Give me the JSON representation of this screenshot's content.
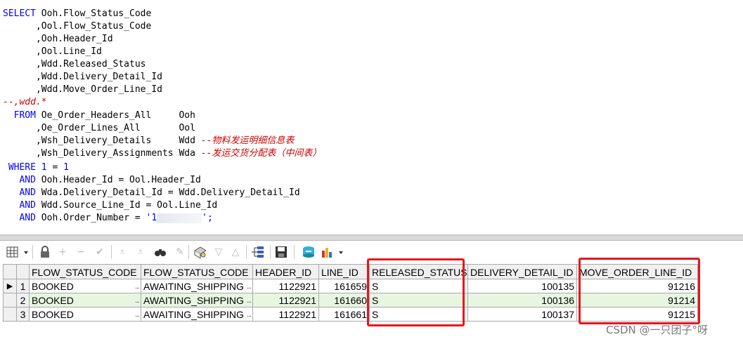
{
  "sql": {
    "line1": "Ooh.Flow_Status_Code",
    "line2": "      ,Ool.Flow_Status_Code",
    "line3": "      ,Ooh.Header_Id",
    "line4": "      ,Ool.Line_Id",
    "line5": "      ,Wdd.Released_Status",
    "line6": "      ,Wdd.Delivery_Detail_Id",
    "line7": "      ,Wdd.Move_Order_Line_Id",
    "line8": "--,wdd.*",
    "kw_select": "SELECT",
    "kw_from": "FROM",
    "kw_where": "WHERE",
    "kw_and": "AND",
    "from1": "Oe_Order_Headers_All     Ooh",
    "from2": "      ,Oe_Order_Lines_All       Ool",
    "from3": "      ,Wsh_Delivery_Details     Wdd ",
    "from3_comment": "--物料发运明细信息表",
    "from4": "      ,Wsh_Delivery_Assignments Wda ",
    "from4_comment": "--发运交货分配表（中间表）",
    "where_lhs": "1",
    "where_eq": " = ",
    "where_rhs": "1",
    "and1": "Ooh.Header_Id = Ool.Header_Id",
    "and2": "Wda.Delivery_Detail_Id = Wdd.Delivery_Detail_Id",
    "and3": "Wdd.Source_Line_Id = Ool.Line_Id",
    "and4_pre": "Ooh.Order_Number = ",
    "and4_q1": "'1",
    "and4_q2": "';"
  },
  "toolbar": {
    "icons": [
      "grid-menu-icon",
      "lock-icon",
      "add-row-icon",
      "delete-row-icon",
      "post-icon",
      "fetch-next-icon",
      "fetch-last-icon",
      "find-icon",
      "clear-icon",
      "query-by-example-icon",
      "filter-icon",
      "sort-icon",
      "explain-icon",
      "save-icon",
      "export-icon",
      "chart-icon"
    ]
  },
  "grid": {
    "columns": [
      "FLOW_STATUS_CODE",
      "FLOW_STATUS_CODE",
      "HEADER_ID",
      "LINE_ID",
      "RELEASED_STATUS",
      "DELIVERY_DETAIL_ID",
      "MOVE_ORDER_LINE_ID"
    ],
    "rows": [
      {
        "num": "1",
        "c1": "BOOKED",
        "c2": "AWAITING_SHIPPING",
        "c3": "1122921",
        "c4": "161659",
        "c5": "S",
        "c6": "100135",
        "c7": "91216"
      },
      {
        "num": "2",
        "c1": "BOOKED",
        "c2": "AWAITING_SHIPPING",
        "c3": "1122921",
        "c4": "161660",
        "c5": "S",
        "c6": "100136",
        "c7": "91214"
      },
      {
        "num": "3",
        "c1": "BOOKED",
        "c2": "AWAITING_SHIPPING",
        "c3": "1122921",
        "c4": "161661",
        "c5": "S",
        "c6": "100137",
        "c7": "91215"
      }
    ],
    "ellipsis": "...",
    "current_row_marker": "▶"
  },
  "watermark": "CSDN @一只团子°呀",
  "colors": {
    "keyword": "#0000ff",
    "comment": "#cc0000",
    "highlight_box": "#e8141f",
    "row_alt": "#e7f6e0"
  }
}
